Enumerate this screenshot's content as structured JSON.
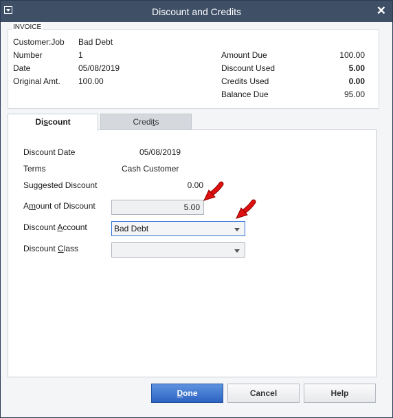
{
  "window": {
    "title": "Discount and Credits"
  },
  "invoice": {
    "section_label": "INVOICE",
    "customer_job_label": "Customer:Job",
    "customer_job": "Bad Debt",
    "number_label": "Number",
    "number": "1",
    "date_label": "Date",
    "date": "05/08/2019",
    "original_amt_label": "Original Amt.",
    "original_amt": "100.00",
    "amount_due_label": "Amount Due",
    "amount_due": "100.00",
    "discount_used_label": "Discount Used",
    "discount_used": "5.00",
    "credits_used_label": "Credits Used",
    "credits_used": "0.00",
    "balance_due_label": "Balance Due",
    "balance_due": "95.00"
  },
  "tabs": [
    {
      "pre": "Di",
      "key": "s",
      "post": "count",
      "active": true
    },
    {
      "pre": "Credi",
      "key": "t",
      "post": "s",
      "active": false
    }
  ],
  "discount": {
    "discount_date_label": "Discount Date",
    "discount_date": "05/08/2019",
    "terms_label": "Terms",
    "terms": "Cash Customer",
    "suggested_label": "Suggested Discount",
    "suggested": "0.00",
    "amount_label_pre": "A",
    "amount_label_key": "m",
    "amount_label_post": "ount of Discount",
    "amount": "5.00",
    "account_label_pre": "Discount ",
    "account_label_key": "A",
    "account_label_post": "ccount",
    "account": "Bad Debt",
    "class_label_pre": "Discount ",
    "class_label_key": "C",
    "class_label_post": "lass",
    "class": ""
  },
  "buttons": {
    "done_key": "D",
    "done_rest": "one",
    "cancel": "Cancel",
    "help": "Help"
  },
  "colors": {
    "titlebar": "#3e4f66",
    "primary_button": "#2c63c1",
    "annotation_arrow": "#e01010"
  }
}
